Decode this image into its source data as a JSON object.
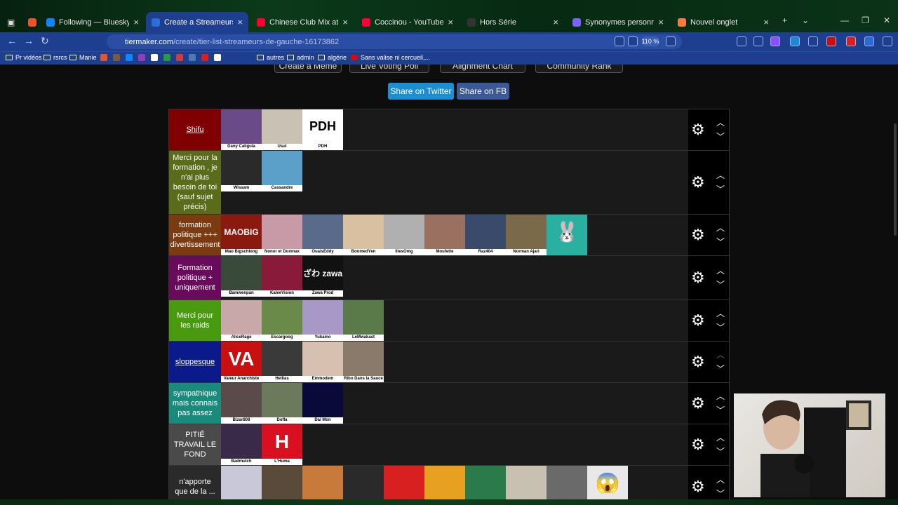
{
  "tabs": [
    {
      "title": "",
      "color": "#e8552a",
      "icon": "firefox-icon"
    },
    {
      "title": "Following — Bluesky",
      "color": "#1185fe",
      "icon": "butterfly-icon"
    },
    {
      "title": "Create a Streameurs de Gauche",
      "color": "#2b6ed8",
      "icon": "tiermaker-icon"
    },
    {
      "title": "Chinese Club Mix at a Senior Ce",
      "color": "#ff0033",
      "icon": "youtube-icon"
    },
    {
      "title": "Coccinou - YouTube",
      "color": "#ff0033",
      "icon": "youtube-icon"
    },
    {
      "title": "Hors Série",
      "color": "#333333",
      "icon": "hs-icon"
    },
    {
      "title": "Synonymes personnalité - Deep",
      "color": "#7b61ff",
      "icon": "deepl-icon"
    },
    {
      "title": "Nouvel onglet",
      "color": "#ff7a3d",
      "icon": "newtab-icon"
    }
  ],
  "address": {
    "domain": "tiermaker.com",
    "path": "/create/tier-list-streameurs-de-gauche-16173862",
    "zoom": "110 %"
  },
  "bookmarks": [
    "Pr vidéos",
    "rsrcs",
    "Manie",
    "autres",
    "admin",
    "algérie",
    "Sans valise ni cercueil,..."
  ],
  "top_buttons": [
    "Create a Meme",
    "Live Voting Poll",
    "Alignment Chart",
    "Community Rank"
  ],
  "share": {
    "twitter": "Share on Twitter",
    "fb": "Share on FB"
  },
  "tiers": [
    {
      "label": "Shifu",
      "color": "#7f0000",
      "underline": true,
      "height": 59,
      "items": [
        {
          "name": "Dany Caligula",
          "bg": "#6b4a8a"
        },
        {
          "name": "Usul",
          "bg": "#c9c2b4"
        },
        {
          "name": "PDH",
          "bg": "#ffffff",
          "glyph": "PDH"
        }
      ]
    },
    {
      "label": "Merci pour la formation , je n'ai plus besoin de toi (sauf sujet précis)",
      "color": "#5a6b1a",
      "height": 91,
      "items": [
        {
          "name": "Wissam",
          "bg": "#2a2a2a"
        },
        {
          "name": "Cassandre",
          "bg": "#5aa0c8"
        }
      ]
    },
    {
      "label": "formation politique +++ divertissement",
      "color": "#7a3b10",
      "height": 59,
      "items": [
        {
          "name": "Mao Bigschlong",
          "bg": "#8a1a10",
          "glyph": "MAOBIG"
        },
        {
          "name": "Nonor et Donmax",
          "bg": "#c89aa8"
        },
        {
          "name": "OuaisEddy",
          "bg": "#5a6a8a"
        },
        {
          "name": "BoomedYen",
          "bg": "#d8c0a0"
        },
        {
          "name": "IliesOmg",
          "bg": "#b0b0b0"
        },
        {
          "name": "Moufette",
          "bg": "#9a7060"
        },
        {
          "name": "Raz404",
          "bg": "#3a4a6a"
        },
        {
          "name": "Norman Ajari",
          "bg": "#7a6a4a"
        },
        {
          "name": "",
          "bg": "#2ab0a0",
          "glyph": "🐰"
        }
      ]
    },
    {
      "label": "Formation politique + uniquement",
      "color": "#6a0a5a",
      "height": 63,
      "items": [
        {
          "name": "Bamwenpan",
          "bg": "#3a4a3a"
        },
        {
          "name": "KaleeVision",
          "bg": "#8a1a3a"
        },
        {
          "name": "Zawa Prod",
          "bg": "#111111",
          "glyph": "ざわ zawa"
        }
      ]
    },
    {
      "label": "Merci pour les raids",
      "color": "#4a9a10",
      "height": 59,
      "items": [
        {
          "name": "AliceRage",
          "bg": "#c8a8a8"
        },
        {
          "name": "Escargoog",
          "bg": "#6a8a4a"
        },
        {
          "name": "Yukaino",
          "bg": "#a898c8"
        },
        {
          "name": "LeMwakast",
          "bg": "#5a7a4a"
        }
      ]
    },
    {
      "label": "sloppesque",
      "color": "#0a1a8a",
      "underline": true,
      "height": 59,
      "items": [
        {
          "name": "Valeur Anarchiste",
          "bg": "#c81010",
          "glyph": "VA"
        },
        {
          "name": "Hellias",
          "bg": "#3a3a3a"
        },
        {
          "name": "Emmodem",
          "bg": "#d8c0b0"
        },
        {
          "name": "Ribo Dans la Sauce",
          "bg": "#8a7a6a"
        }
      ]
    },
    {
      "label": "sympathique mais connais pas assez",
      "color": "#1a8a7a",
      "height": 59,
      "items": [
        {
          "name": "Bizar808",
          "bg": "#5a4a4a"
        },
        {
          "name": "Dofla",
          "bg": "#6a7a5a"
        },
        {
          "name": "Dai Mon",
          "bg": "#0a0a3a"
        }
      ]
    },
    {
      "label": "PITIÉ TRAVAIL LE FOND",
      "color": "#4a4a4a",
      "height": 59,
      "items": [
        {
          "name": "Badmulch",
          "bg": "#3a2a4a"
        },
        {
          "name": "L'Huma",
          "bg": "#d81020",
          "glyph": "H"
        }
      ]
    },
    {
      "label": "n'apporte que de la ...",
      "color": "#2a2a2a",
      "height": 60,
      "items": [
        {
          "name": "",
          "bg": "#c8c8d8"
        },
        {
          "name": "",
          "bg": "#5a4a3a"
        },
        {
          "name": "",
          "bg": "#c87a3a"
        },
        {
          "name": "",
          "bg": "#2a2a2a"
        },
        {
          "name": "",
          "bg": "#d82020"
        },
        {
          "name": "",
          "bg": "#e8a020"
        },
        {
          "name": "",
          "bg": "#2a7a4a"
        },
        {
          "name": "",
          "bg": "#c8c0b0"
        },
        {
          "name": "",
          "bg": "#6a6a6a"
        },
        {
          "name": "",
          "bg": "#e8e8e8",
          "glyph": "😱"
        }
      ]
    }
  ]
}
